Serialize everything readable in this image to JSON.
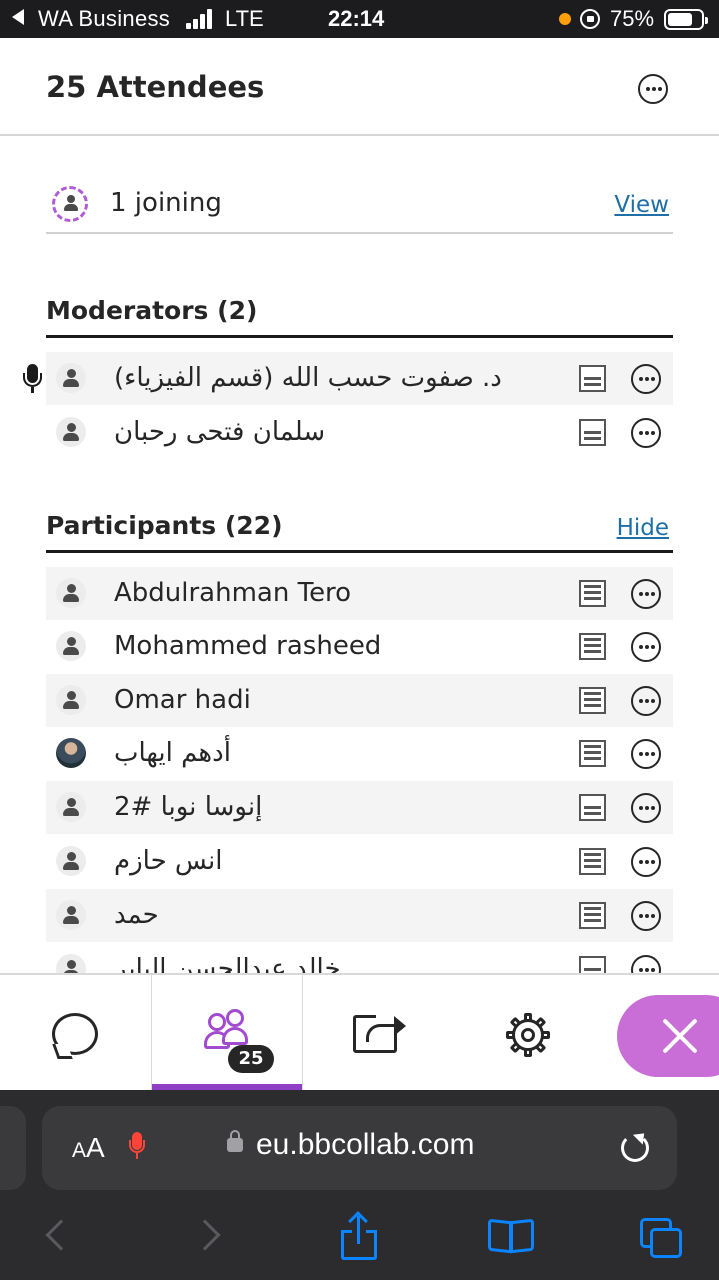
{
  "status_bar": {
    "back_app": "WA Business",
    "network": "LTE",
    "time": "22:14",
    "battery_pct": "75%",
    "battery_level": 0.75
  },
  "header": {
    "title": "25 Attendees",
    "more_icon": "more-options-icon"
  },
  "joining": {
    "label": "1 joining",
    "link": "View"
  },
  "moderators": {
    "title": "Moderators (2)",
    "rows": [
      {
        "name": "د. صفوت حسب الله (قسم الفيزياء)",
        "speaking": true,
        "role_icon": "list-icon-partial"
      },
      {
        "name": "سلمان فتحى رحبان",
        "speaking": false,
        "role_icon": "list-icon-partial"
      }
    ]
  },
  "participants": {
    "title": "Participants (22)",
    "link": "Hide",
    "rows": [
      {
        "name": "Abdulrahman Tero",
        "role_icon": "list-icon-full"
      },
      {
        "name": "Mohammed rasheed",
        "role_icon": "list-icon-full"
      },
      {
        "name": "Omar hadi",
        "role_icon": "list-icon-full"
      },
      {
        "name": "أدهم ايهاب",
        "role_icon": "list-icon-full",
        "has_photo": true
      },
      {
        "name": "إنوسا نوبا #2",
        "role_icon": "list-icon-partial"
      },
      {
        "name": "انس حازم",
        "role_icon": "list-icon-full"
      },
      {
        "name": "حمد",
        "role_icon": "list-icon-full"
      },
      {
        "name": "خالد عبدالحسن الباير",
        "role_icon": "list-icon-partial"
      }
    ]
  },
  "tabbar": {
    "tabs": [
      {
        "id": "chat",
        "icon": "chat-icon"
      },
      {
        "id": "attendees",
        "icon": "people-icon",
        "badge": "25",
        "active": true
      },
      {
        "id": "share",
        "icon": "share-content-icon"
      },
      {
        "id": "settings",
        "icon": "gear-icon"
      }
    ],
    "close_icon": "close-icon",
    "accent": "#8e3fc6"
  },
  "browser": {
    "text_size": "AA",
    "url": "eu.bbcollab.com",
    "accent": "#0a84ff"
  }
}
